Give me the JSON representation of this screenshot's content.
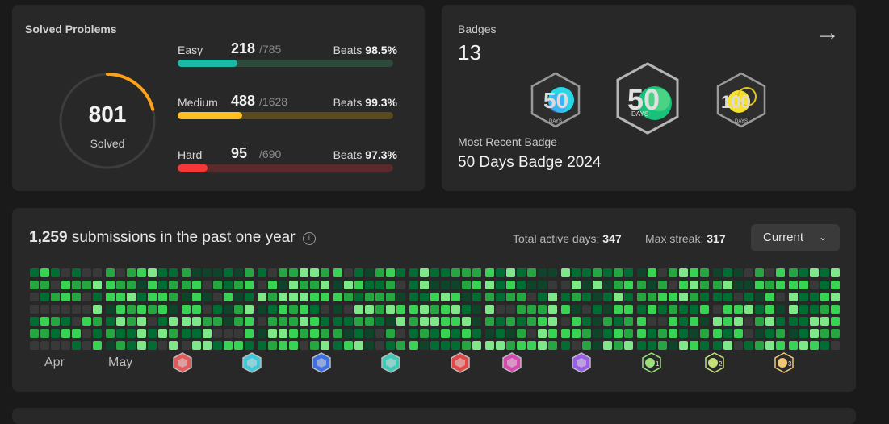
{
  "solved": {
    "title": "Solved Problems",
    "total": "801",
    "total_label": "Solved",
    "ring_fraction": 0.21,
    "difficulties": [
      {
        "name": "Easy",
        "count": "218",
        "total": "/785",
        "beats_label": "Beats",
        "beats": "98.5%",
        "fraction": 0.278,
        "color": "#1cb8a6",
        "track": "#2d4a3b"
      },
      {
        "name": "Medium",
        "count": "488",
        "total": "/1628",
        "beats_label": "Beats",
        "beats": "99.3%",
        "fraction": 0.3,
        "color": "#ffc01e",
        "track": "#5a4a1f"
      },
      {
        "name": "Hard",
        "count": "95",
        "total": "/690",
        "beats_label": "Beats",
        "beats": "97.3%",
        "fraction": 0.138,
        "color": "#f63737",
        "track": "#5b2a2a"
      }
    ]
  },
  "badges": {
    "title": "Badges",
    "count": "13",
    "recent_label": "Most Recent Badge",
    "recent_name": "50 Days Badge 2024",
    "items": [
      {
        "number": "50",
        "caption": "DAYS",
        "color_a": "#28d6e6",
        "color_b": "#4f8fff"
      },
      {
        "number": "50",
        "caption": "DAYS",
        "color_a": "#19c27a",
        "color_b": "#7be38e"
      },
      {
        "number": "100",
        "caption": "DAYS",
        "color_a": "#f5e12e",
        "color_b": "#e0c51a"
      }
    ]
  },
  "heatmap": {
    "submissions": "1,259",
    "submissions_label": "submissions in the past one year",
    "active_label": "Total active days:",
    "active_value": "347",
    "streak_label": "Max streak:",
    "streak_value": "317",
    "select_value": "Current",
    "months": [
      "Apr",
      "May"
    ],
    "monthly_badges": [
      {
        "color": "#e05a5a"
      },
      {
        "color": "#3fc9d8"
      },
      {
        "color": "#3e6fe0"
      },
      {
        "color": "#3ec9b6"
      },
      {
        "color": "#e04848"
      },
      {
        "color": "#d64ab0"
      },
      {
        "color": "#9b5de5"
      },
      {
        "color": "#9be07a",
        "number": "1"
      },
      {
        "color": "#c6e07a",
        "number": "2"
      },
      {
        "color": "#f0c77a",
        "number": "3"
      }
    ]
  }
}
